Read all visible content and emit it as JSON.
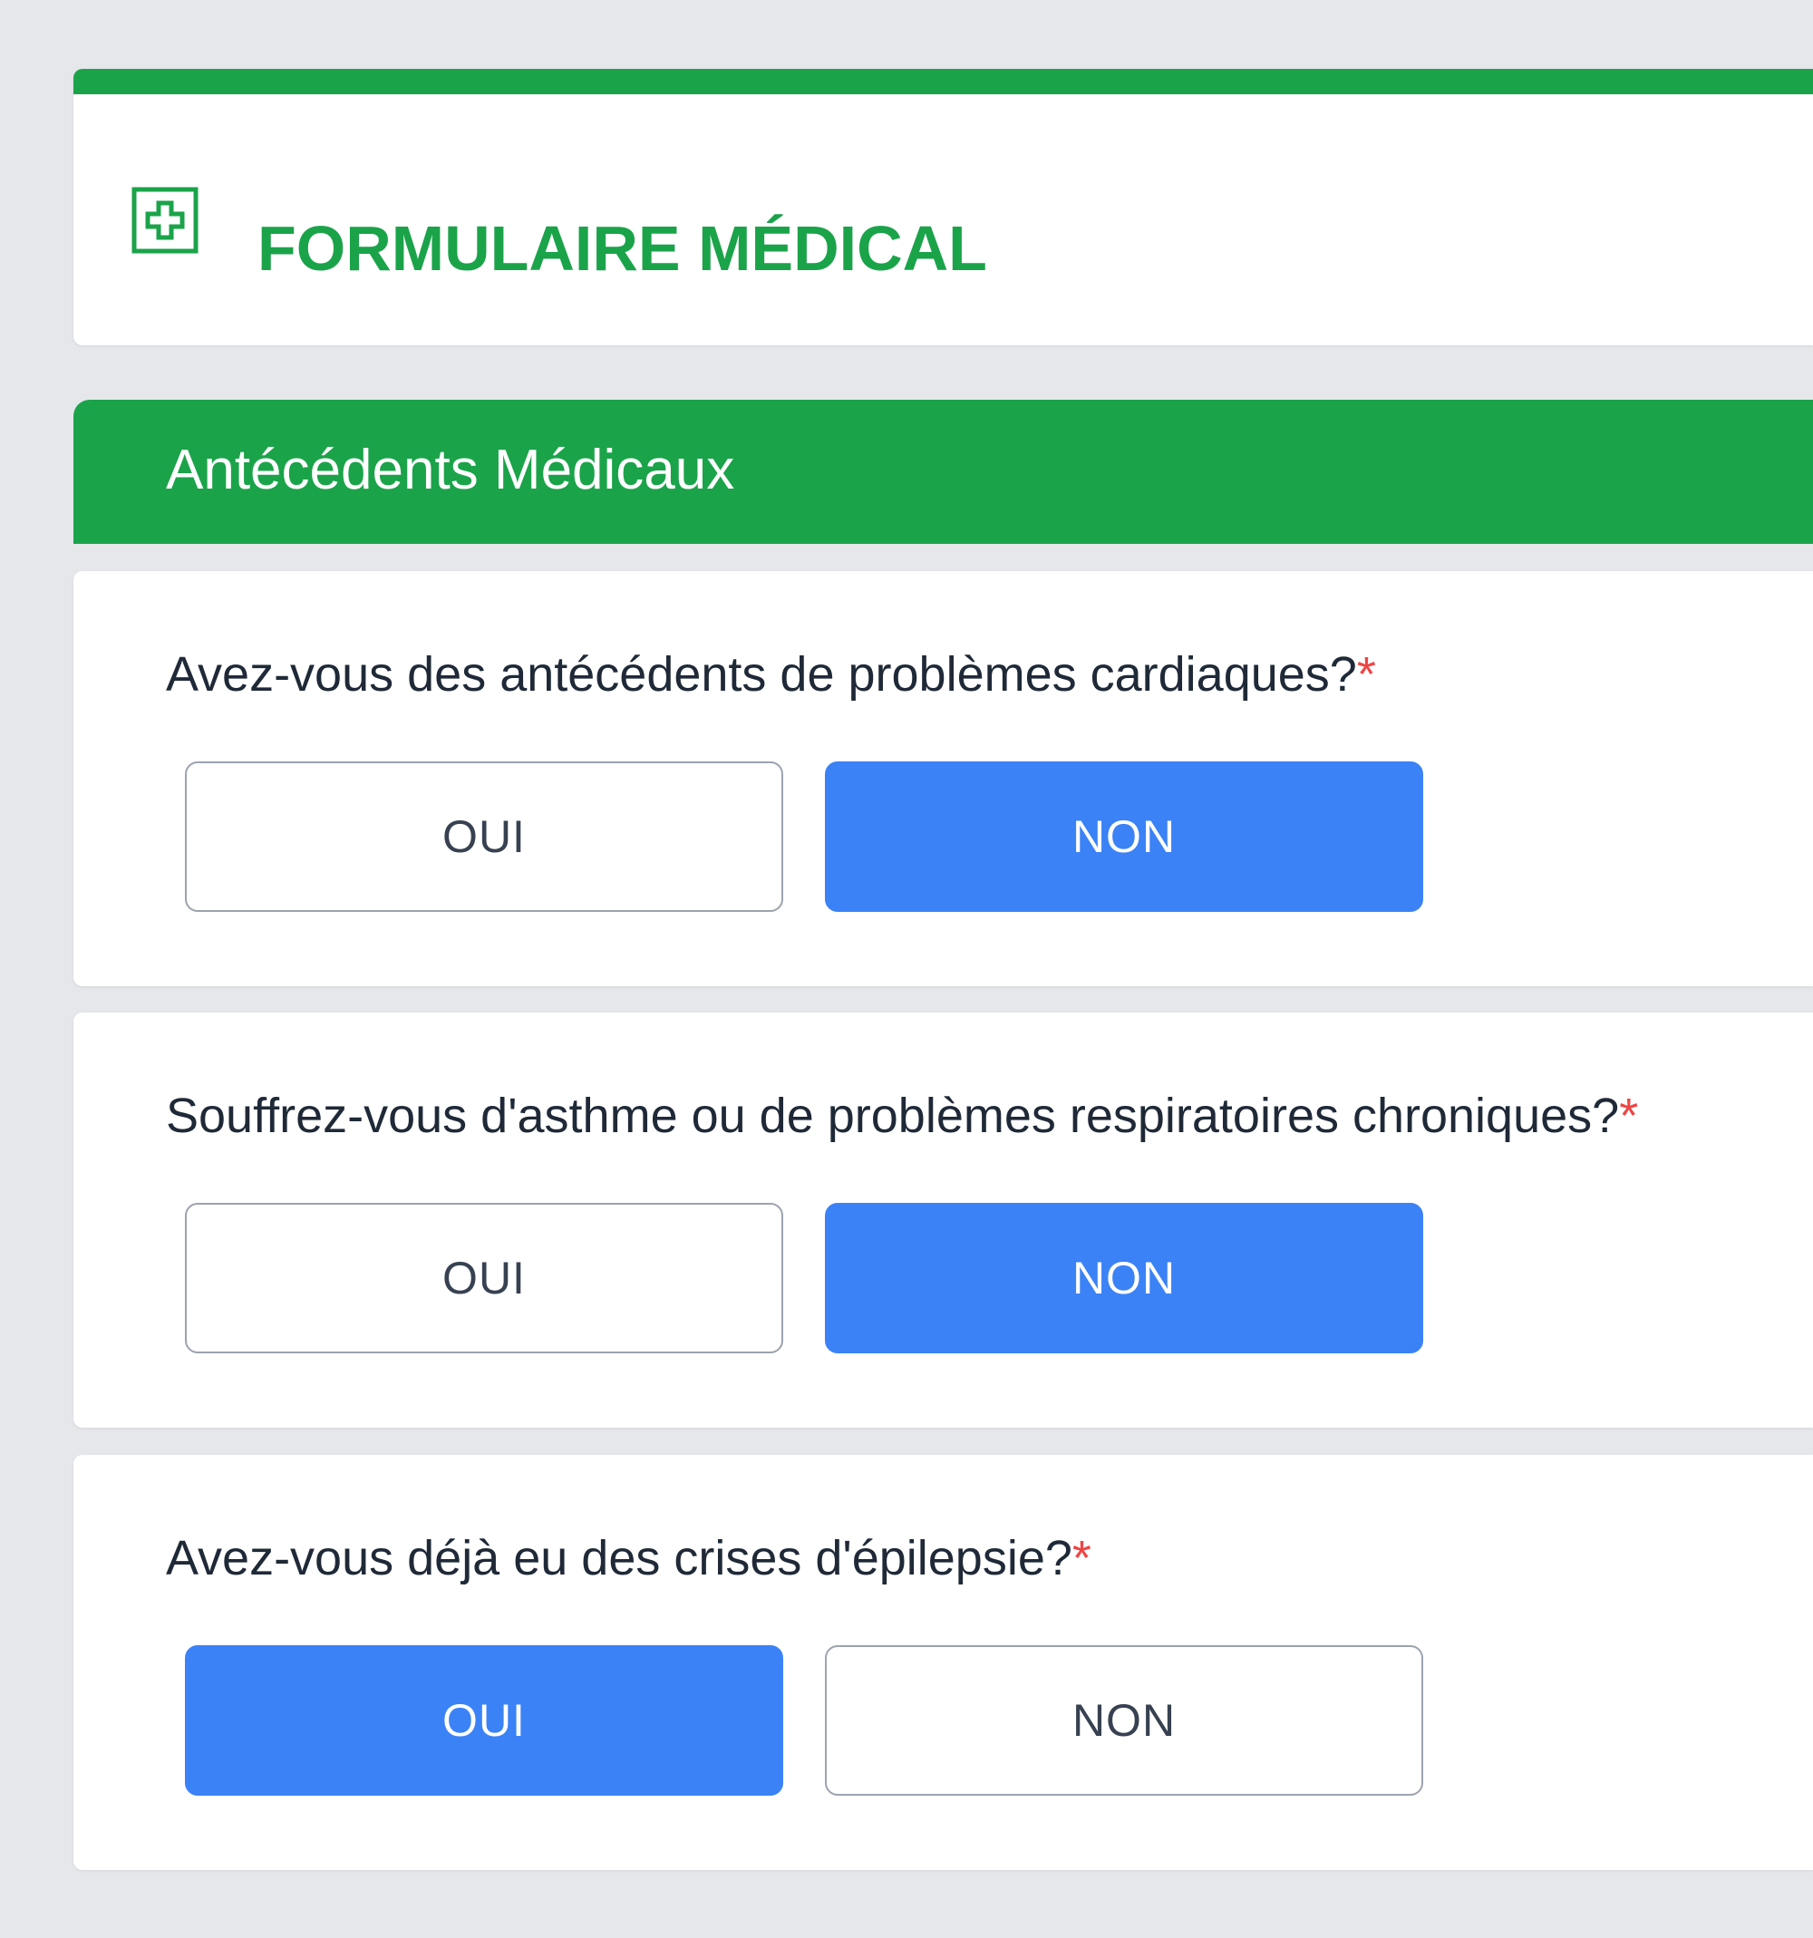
{
  "header": {
    "title": "FORMULAIRE MÉDICAL",
    "icon": "medical-plus-icon"
  },
  "section": {
    "title": "Antécédents Médicaux"
  },
  "questions": [
    {
      "label": "Avez-vous des antécédents de problèmes cardiaques?",
      "required_mark": "*",
      "options": [
        "OUI",
        "NON"
      ],
      "selected": "NON"
    },
    {
      "label": "Souffrez-vous d'asthme ou de problèmes respiratoires chroniques?",
      "required_mark": "*",
      "options": [
        "OUI",
        "NON"
      ],
      "selected": "NON"
    },
    {
      "label": "Avez-vous déjà eu des crises d'épilepsie?",
      "required_mark": "*",
      "options": [
        "OUI",
        "NON"
      ],
      "selected": "OUI"
    }
  ],
  "colors": {
    "brand_green": "#1ba34a",
    "selected_blue": "#3b82f6",
    "required_red": "#ef4444",
    "page_background": "#e5e7eb"
  }
}
